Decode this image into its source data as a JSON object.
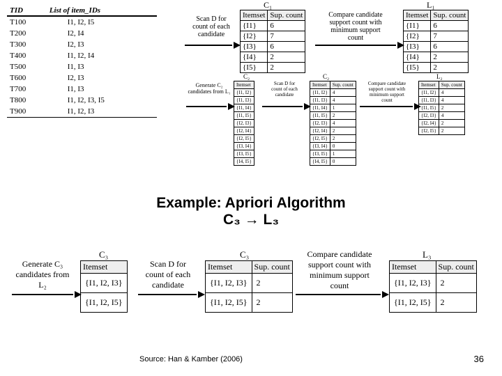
{
  "db": {
    "headers": [
      "TID",
      "List of item_IDs"
    ],
    "rows": [
      [
        "T100",
        "I1, I2, I5"
      ],
      [
        "T200",
        "I2, I4"
      ],
      [
        "T300",
        "I2, I3"
      ],
      [
        "T400",
        "I1, I2, I4"
      ],
      [
        "T500",
        "I1, I3"
      ],
      [
        "T600",
        "I2, I3"
      ],
      [
        "T700",
        "I1, I3"
      ],
      [
        "T800",
        "I1, I2, I3, I5"
      ],
      [
        "T900",
        "I1, I2, I3"
      ]
    ]
  },
  "top": {
    "c1_title": "C₁",
    "c1_headers": [
      "Itemset",
      "Sup. count"
    ],
    "c1_rows": [
      [
        "{I1}",
        "6"
      ],
      [
        "{I2}",
        "7"
      ],
      [
        "{I3}",
        "6"
      ],
      [
        "{I4}",
        "2"
      ],
      [
        "{I5}",
        "2"
      ]
    ],
    "l1_title": "L₁",
    "l1_headers": [
      "Itemset",
      "Sup. count"
    ],
    "l1_rows": [
      [
        "{I1}",
        "6"
      ],
      [
        "{I2}",
        "7"
      ],
      [
        "{I3}",
        "6"
      ],
      [
        "{I4}",
        "2"
      ],
      [
        "{I5}",
        "2"
      ]
    ],
    "a1_label": "Scan D for\ncount of each\ncandidate",
    "a2_label": "Compare candidate\nsupport count with\nminimum support\ncount"
  },
  "mid": {
    "gen_label": "Generate C₂\ncandidates from L₁",
    "c2a_title": "C₂",
    "c2a_header": "Itemset",
    "c2a_rows": [
      "{I1, I2}",
      "{I1, I3}",
      "{I1, I4}",
      "{I1, I5}",
      "{I2, I3}",
      "{I2, I4}",
      "{I2, I5}",
      "{I3, I4}",
      "{I3, I5}",
      "{I4, I5}"
    ],
    "scan_label": "Scan D for\ncount of each\ncandidate",
    "c2b_title": "C₂",
    "c2b_headers": [
      "Itemset",
      "Sup. count"
    ],
    "c2b_rows": [
      [
        "{I1, I2}",
        "4"
      ],
      [
        "{I1, I3}",
        "4"
      ],
      [
        "{I1, I4}",
        "1"
      ],
      [
        "{I1, I5}",
        "2"
      ],
      [
        "{I2, I3}",
        "4"
      ],
      [
        "{I2, I4}",
        "2"
      ],
      [
        "{I2, I5}",
        "2"
      ],
      [
        "{I3, I4}",
        "0"
      ],
      [
        "{I3, I5}",
        "1"
      ],
      [
        "{I4, I5}",
        "0"
      ]
    ],
    "cmp_label": "Compare candidate\nsupport count with\nminimum support\ncount",
    "l2_title": "L₂",
    "l2_headers": [
      "Itemset",
      "Sup. count"
    ],
    "l2_rows": [
      [
        "{I1, I2}",
        "4"
      ],
      [
        "{I1, I3}",
        "4"
      ],
      [
        "{I1, I5}",
        "2"
      ],
      [
        "{I2, I3}",
        "4"
      ],
      [
        "{I2, I4}",
        "2"
      ],
      [
        "{I2, I5}",
        "2"
      ]
    ]
  },
  "bot": {
    "title": "Example: Apriori Algorithm\nC₃ → L₃",
    "gen_label": "Generate C₃\ncandidates from\nL₂",
    "c3a_title": "C₃",
    "c3a_header": "Itemset",
    "c3a_rows": [
      "{I1, I2, I3}",
      "{I1, I2, I5}"
    ],
    "scan_label": "Scan D for\ncount of each\ncandidate",
    "c3b_title": "C₃",
    "c3b_headers": [
      "Itemset",
      "Sup. count"
    ],
    "c3b_rows": [
      [
        "{I1, I2, I3}",
        "2"
      ],
      [
        "{I1, I2, I5}",
        "2"
      ]
    ],
    "cmp_label": "Compare candidate\nsupport count with\nminimum support\ncount",
    "l3_title": "L₃",
    "l3_headers": [
      "Itemset",
      "Sup. count"
    ],
    "l3_rows": [
      [
        "{I1, I2, I3}",
        "2"
      ],
      [
        "{I1, I2, I5}",
        "2"
      ]
    ]
  },
  "source": "Source: Han & Kamber (2006)",
  "page": "36"
}
